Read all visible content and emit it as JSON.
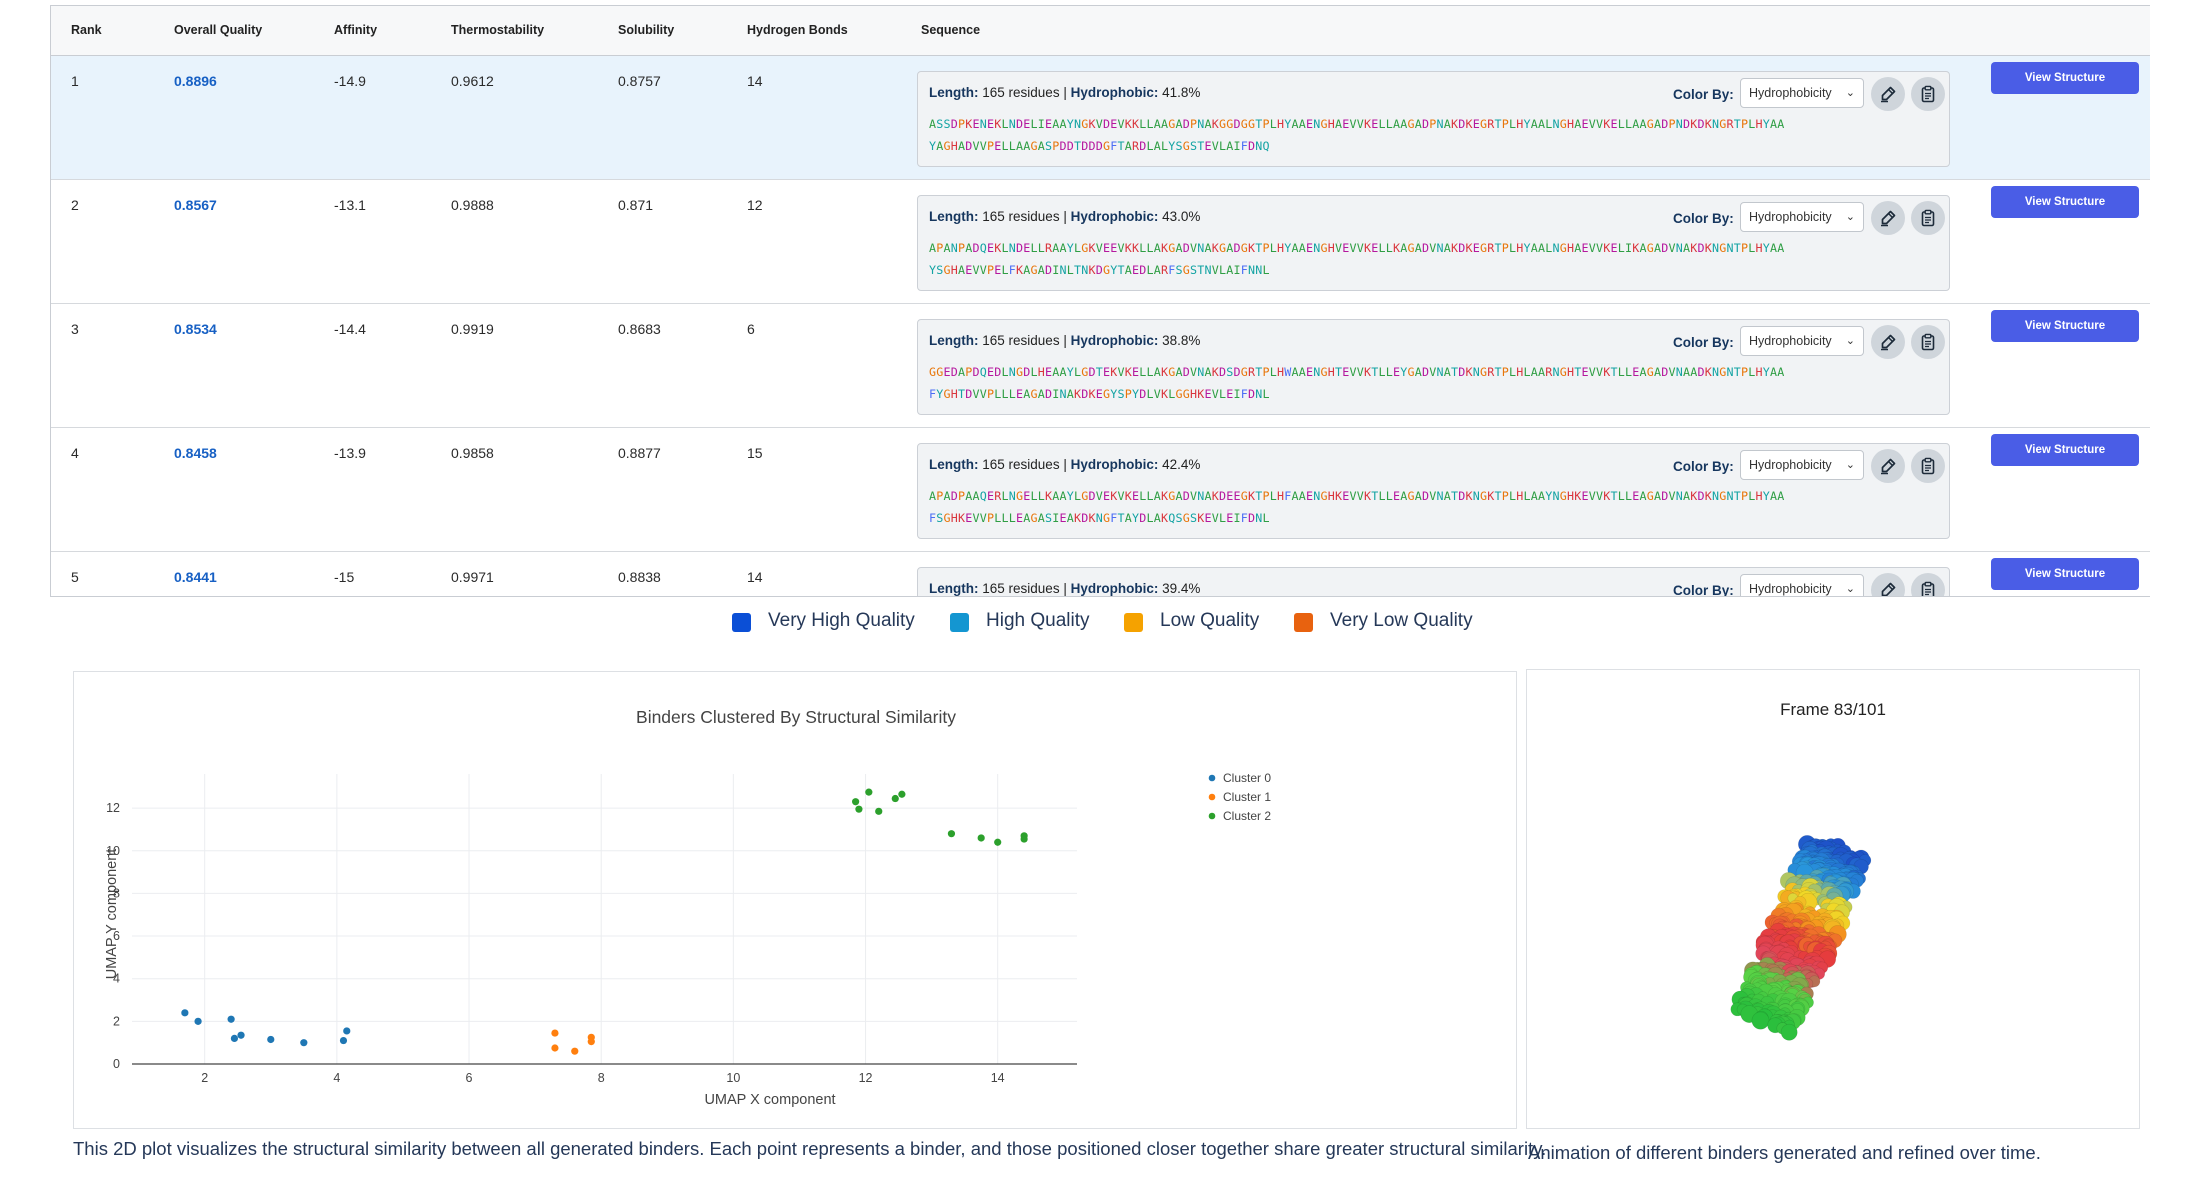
{
  "table": {
    "headers": [
      "Rank",
      "Overall Quality",
      "Affinity",
      "Thermostability",
      "Solubility",
      "Hydrogen Bonds",
      "Sequence"
    ],
    "rows": [
      {
        "rank": "1",
        "quality": "0.8896",
        "affinity": "-14.9",
        "thermostability": "0.9612",
        "solubility": "0.8757",
        "hbonds": "14",
        "length_label": "Length:",
        "length_value": "165 residues",
        "hydrophobic_label": "Hydrophobic:",
        "hydrophobic_value": "41.8%",
        "seq_line1": "ASSDPKENEKLNDELIEAAYNGKVDEVKKLLAAGADPNAKGGDGGTPLHYAAENGHAEVVKELLAAGADPNAKDKEGRTPLHYAALNGHAEVVKELLAAGADPNDKDKNGRTPLHYAA",
        "seq_line2": "YAGHADVVPELLAAGASPDDTDDDGFTARDLALYSGSTEVLAIFDNQ"
      },
      {
        "rank": "2",
        "quality": "0.8567",
        "affinity": "-13.1",
        "thermostability": "0.9888",
        "solubility": "0.871",
        "hbonds": "12",
        "length_label": "Length:",
        "length_value": "165 residues",
        "hydrophobic_label": "Hydrophobic:",
        "hydrophobic_value": "43.0%",
        "seq_line1": "APANPADQEKLNDELLRAAYLGKVEEVKKLLAKGADVNAKGADGKTPLHYAAENGHVEVVKELLKAGADVNAKDKEGRTPLHYAALNGHAEVVKELIKAGADVNAKDKNGNTPLHYAA",
        "seq_line2": "YSGHAEVVPELFKAGADINLTNKDGYTAEDLARFSGSTNVLAIFNNL"
      },
      {
        "rank": "3",
        "quality": "0.8534",
        "affinity": "-14.4",
        "thermostability": "0.9919",
        "solubility": "0.8683",
        "hbonds": "6",
        "length_label": "Length:",
        "length_value": "165 residues",
        "hydrophobic_label": "Hydrophobic:",
        "hydrophobic_value": "38.8%",
        "seq_line1": "GGEDAPDQEDLNGDLHEAAYLGDTEKVKELLAKGADVNAKDSDGRTPLHWAAENGHTEVVKTLLEYGADVNATDKNGRTPLHLAARNGHTEVVKTLLEAGADVNAADKNGNTPLHYAA",
        "seq_line2": "FYGHTDVVPLLLEAGADINAKDKEGYSPYDLVKLGGHKEVLEIFDNL"
      },
      {
        "rank": "4",
        "quality": "0.8458",
        "affinity": "-13.9",
        "thermostability": "0.9858",
        "solubility": "0.8877",
        "hbonds": "15",
        "length_label": "Length:",
        "length_value": "165 residues",
        "hydrophobic_label": "Hydrophobic:",
        "hydrophobic_value": "42.4%",
        "seq_line1": "APADPAAQERLNGELLKAAYLGDVEKVKELLAKGADVNAKDEEGKTPLHFAAENGHKEVVKTLLEAGADVNATDKNGKTPLHLAAYNGHKEVVKTLLEAGADVNAKDKNGNTPLHYAA",
        "seq_line2": "FSGHKEVVPLLLEAGASIEAKDKNGFTAYDLAKQSGSKEVLEIFDNL"
      },
      {
        "rank": "5",
        "quality": "0.8441",
        "affinity": "-15",
        "thermostability": "0.9971",
        "solubility": "0.8838",
        "hbonds": "14",
        "length_label": "Length:",
        "length_value": "165 residues",
        "hydrophobic_label": "Hydrophobic:",
        "hydrophobic_value": "39.4%",
        "seq_line1": "",
        "seq_line2": ""
      }
    ],
    "color_by_label": "Color By:",
    "color_by_value": "Hydrophobicity",
    "view_button_label": "View Structure",
    "residue_colors": {
      "hydrophobic": "#2f9e44",
      "polar": "#13a3a3",
      "positive": "#d9363e",
      "negative": "#b5179e",
      "special": "#e8760a",
      "aromatic": "#4c6ef5"
    }
  },
  "quality_legend": [
    {
      "label": "Very High Quality",
      "color": "#0b4fd6"
    },
    {
      "label": "High Quality",
      "color": "#1496d1"
    },
    {
      "label": "Low Quality",
      "color": "#f5a200"
    },
    {
      "label": "Very Low Quality",
      "color": "#e8620f"
    }
  ],
  "chart_data": {
    "type": "scatter",
    "title": "Binders Clustered By Structural Similarity",
    "xlabel": "UMAP X component",
    "ylabel": "UMAP Y component",
    "xlim": [
      0.9,
      15.2
    ],
    "ylim": [
      0,
      13.6
    ],
    "xticks": [
      2,
      4,
      6,
      8,
      10,
      12,
      14
    ],
    "yticks": [
      0,
      2,
      4,
      6,
      8,
      10,
      12
    ],
    "grid": true,
    "legend_position": "top-right",
    "series": [
      {
        "name": "Cluster 0",
        "color": "#1f77b4",
        "points": [
          [
            1.7,
            2.4
          ],
          [
            1.9,
            2.0
          ],
          [
            2.4,
            2.1
          ],
          [
            2.45,
            1.2
          ],
          [
            2.55,
            1.35
          ],
          [
            3.0,
            1.15
          ],
          [
            3.5,
            1.0
          ],
          [
            4.1,
            1.1
          ],
          [
            4.15,
            1.55
          ]
        ]
      },
      {
        "name": "Cluster 1",
        "color": "#ff7f0e",
        "points": [
          [
            7.3,
            1.45
          ],
          [
            7.3,
            0.75
          ],
          [
            7.6,
            0.6
          ],
          [
            7.85,
            1.25
          ],
          [
            7.85,
            1.05
          ]
        ]
      },
      {
        "name": "Cluster 2",
        "color": "#2ca02c",
        "points": [
          [
            11.85,
            12.3
          ],
          [
            11.9,
            11.95
          ],
          [
            12.05,
            12.75
          ],
          [
            12.2,
            11.85
          ],
          [
            12.45,
            12.45
          ],
          [
            12.55,
            12.65
          ],
          [
            13.3,
            10.8
          ],
          [
            13.75,
            10.6
          ],
          [
            14.0,
            10.4
          ],
          [
            14.4,
            10.55
          ],
          [
            14.4,
            10.7
          ]
        ]
      }
    ]
  },
  "scatter_caption": "This 2D plot visualizes the structural similarity between all generated binders. Each point represents a binder, and those positioned closer together share greater structural similarity.",
  "structure": {
    "frame_label": "Frame 83/101",
    "caption": "Animation of different binders generated and refined over time."
  }
}
